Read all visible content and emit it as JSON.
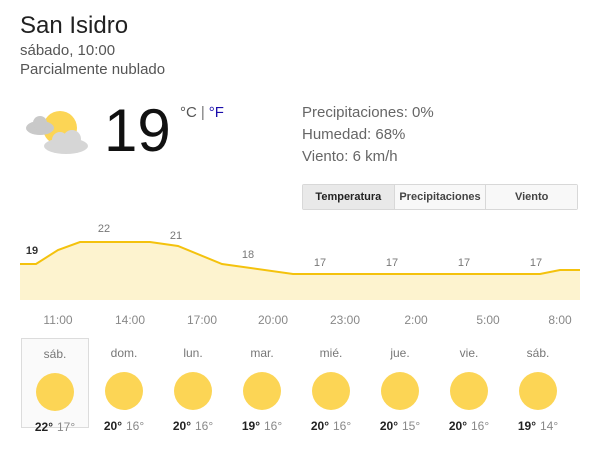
{
  "location": "San Isidro",
  "datetime": "sábado, 10:00",
  "condition": "Parcialmente nublado",
  "current": {
    "icon": "partly-cloudy-icon",
    "temp": "19",
    "unit_c": "°C",
    "unit_sep": "|",
    "unit_f": "°F"
  },
  "details": {
    "precip": "Precipitaciones: 0%",
    "humidity": "Humedad: 68%",
    "wind": "Viento: 6 km/h"
  },
  "tabs": [
    {
      "label": "Temperatura",
      "active": true
    },
    {
      "label": "Precipitaciones",
      "active": false
    },
    {
      "label": "Viento",
      "active": false
    }
  ],
  "colors": {
    "line": "#f4c20d",
    "fill": "#fdf3cf",
    "sun": "#fcd555"
  },
  "chart_data": {
    "type": "area",
    "x": [
      "11:00",
      "14:00",
      "17:00",
      "20:00",
      "23:00",
      "2:00",
      "5:00",
      "8:00"
    ],
    "values": [
      19,
      22,
      21,
      18,
      17,
      17,
      17,
      17
    ]
  },
  "forecast": [
    {
      "day": "sáb.",
      "hi": "22°",
      "lo": "17°",
      "icon": "sun-icon",
      "selected": true
    },
    {
      "day": "dom.",
      "hi": "20°",
      "lo": "16°",
      "icon": "sun-icon"
    },
    {
      "day": "lun.",
      "hi": "20°",
      "lo": "16°",
      "icon": "sun-icon"
    },
    {
      "day": "mar.",
      "hi": "19°",
      "lo": "16°",
      "icon": "sun-icon"
    },
    {
      "day": "mié.",
      "hi": "20°",
      "lo": "16°",
      "icon": "sun-icon"
    },
    {
      "day": "jue.",
      "hi": "20°",
      "lo": "15°",
      "icon": "sun-icon"
    },
    {
      "day": "vie.",
      "hi": "20°",
      "lo": "16°",
      "icon": "sun-icon"
    },
    {
      "day": "sáb.",
      "hi": "19°",
      "lo": "14°",
      "icon": "sun-icon"
    }
  ]
}
